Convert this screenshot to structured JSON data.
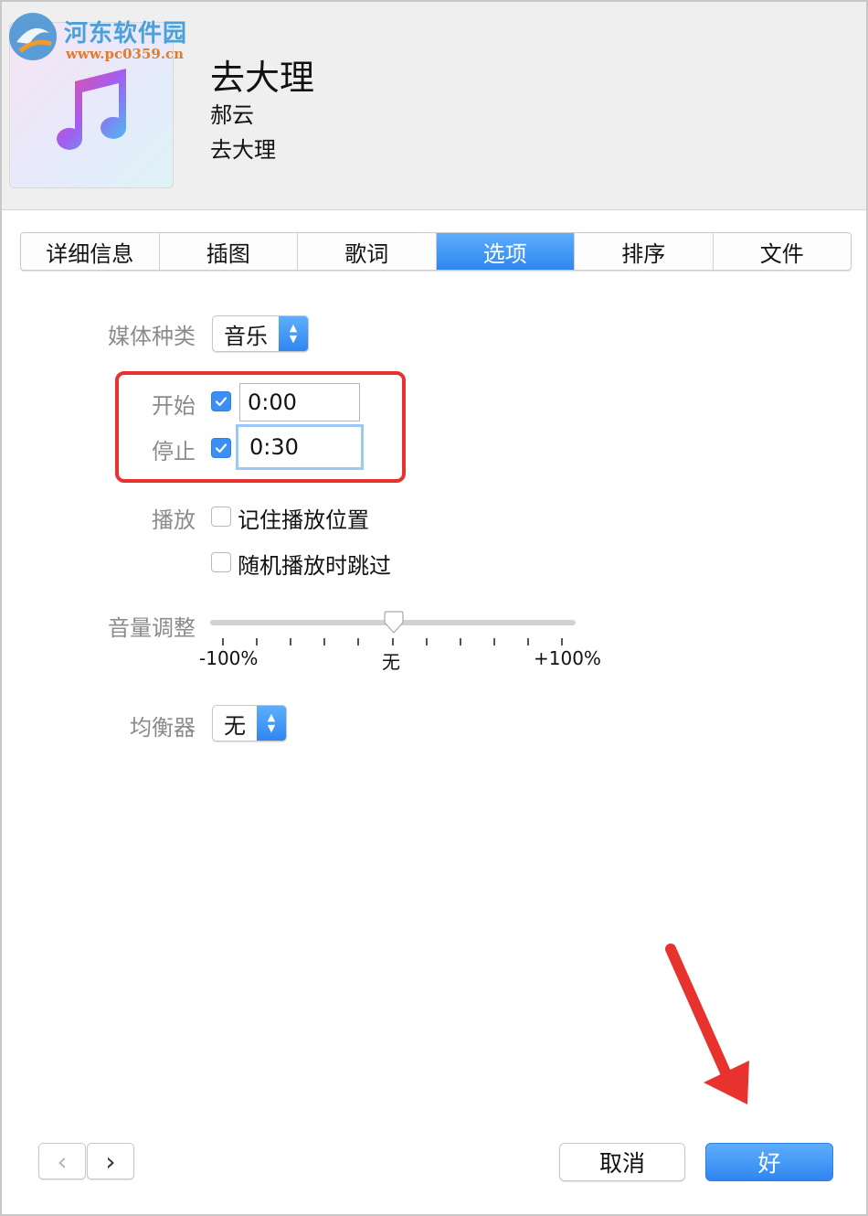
{
  "watermark": {
    "title": "河东软件园",
    "url": "www.pc0359.cn"
  },
  "song": {
    "title": "去大理",
    "artist": "郝云",
    "album": "去大理"
  },
  "tabs": [
    {
      "label": "详细信息",
      "active": false
    },
    {
      "label": "插图",
      "active": false
    },
    {
      "label": "歌词",
      "active": false
    },
    {
      "label": "选项",
      "active": true
    },
    {
      "label": "排序",
      "active": false
    },
    {
      "label": "文件",
      "active": false
    }
  ],
  "options": {
    "media_kind_label": "媒体种类",
    "media_kind_value": "音乐",
    "start_label": "开始",
    "start_checked": true,
    "start_value": "0:00",
    "stop_label": "停止",
    "stop_checked": true,
    "stop_value": "0:30",
    "playback_label": "播放",
    "remember_position": "记住播放位置",
    "remember_position_checked": false,
    "skip_shuffle": "随机播放时跳过",
    "skip_shuffle_checked": false,
    "volume_label": "音量调整",
    "volume_min": "-100%",
    "volume_mid": "无",
    "volume_max": "+100%",
    "volume_value": 0,
    "eq_label": "均衡器",
    "eq_value": "无"
  },
  "footer": {
    "prev_icon": "chevron-left-icon",
    "next_icon": "chevron-right-icon",
    "cancel_label": "取消",
    "ok_label": "好"
  },
  "colors": {
    "accent": "#3a8ff5",
    "annotation_red": "#e8322e"
  }
}
